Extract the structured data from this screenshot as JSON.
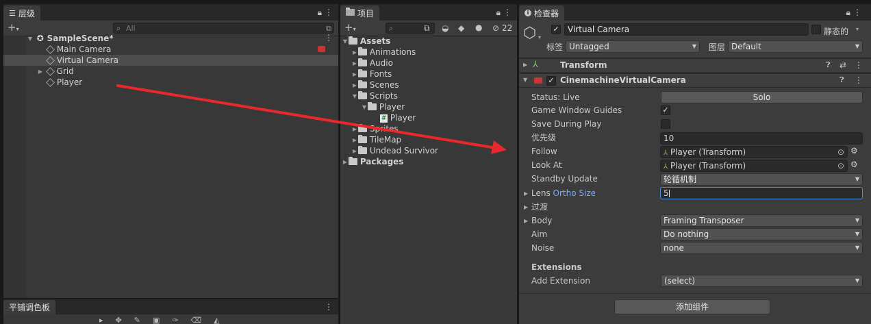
{
  "hierarchy": {
    "tab_label": "层级",
    "search_placeholder": "All",
    "scene_name": "SampleScene*",
    "items": [
      "Main Camera",
      "Virtual Camera",
      "Grid",
      "Player"
    ]
  },
  "tile_palette": {
    "tab_label": "平铺调色板"
  },
  "project": {
    "tab_label": "项目",
    "hidden_count": "22",
    "tree": [
      {
        "label": "Assets"
      },
      {
        "label": "Animations"
      },
      {
        "label": "Audio"
      },
      {
        "label": "Fonts"
      },
      {
        "label": "Scenes"
      },
      {
        "label": "Scripts"
      },
      {
        "label": "Player"
      },
      {
        "label": "Player"
      },
      {
        "label": "Sprites"
      },
      {
        "label": "TileMap"
      },
      {
        "label": "Undead Survivor"
      },
      {
        "label": "Packages"
      }
    ]
  },
  "inspector": {
    "tab_label": "检查器",
    "object_name": "Virtual Camera",
    "static_label": "静态的",
    "tag_label": "标签",
    "tag_value": "Untagged",
    "layer_label": "图层",
    "layer_value": "Default",
    "transform_label": "Transform",
    "component_label": "CinemachineVirtualCamera",
    "status_label": "Status: Live",
    "solo_label": "Solo",
    "game_window_guides_label": "Game Window Guides",
    "save_during_play_label": "Save During Play",
    "priority_label": "优先级",
    "priority_value": "10",
    "follow_label": "Follow",
    "follow_value": "Player (Transform)",
    "look_at_label": "Look At",
    "look_at_value": "Player (Transform)",
    "standby_update_label": "Standby Update",
    "standby_update_value": "轮循机制",
    "lens_label": "Lens",
    "lens_ortho_label": "Ortho Size",
    "lens_value": "5",
    "transitions_label": "过渡",
    "body_label": "Body",
    "body_value": "Framing Transposer",
    "aim_label": "Aim",
    "aim_value": "Do nothing",
    "noise_label": "Noise",
    "noise_value": "none",
    "extensions_label": "Extensions",
    "add_extension_label": "Add Extension",
    "add_extension_value": "(select)",
    "add_component_label": "添加组件"
  },
  "colors": {
    "annotation_arrow": "#e8282b",
    "link_blue": "#7ab0ff",
    "selection": "#4d4d4d"
  }
}
